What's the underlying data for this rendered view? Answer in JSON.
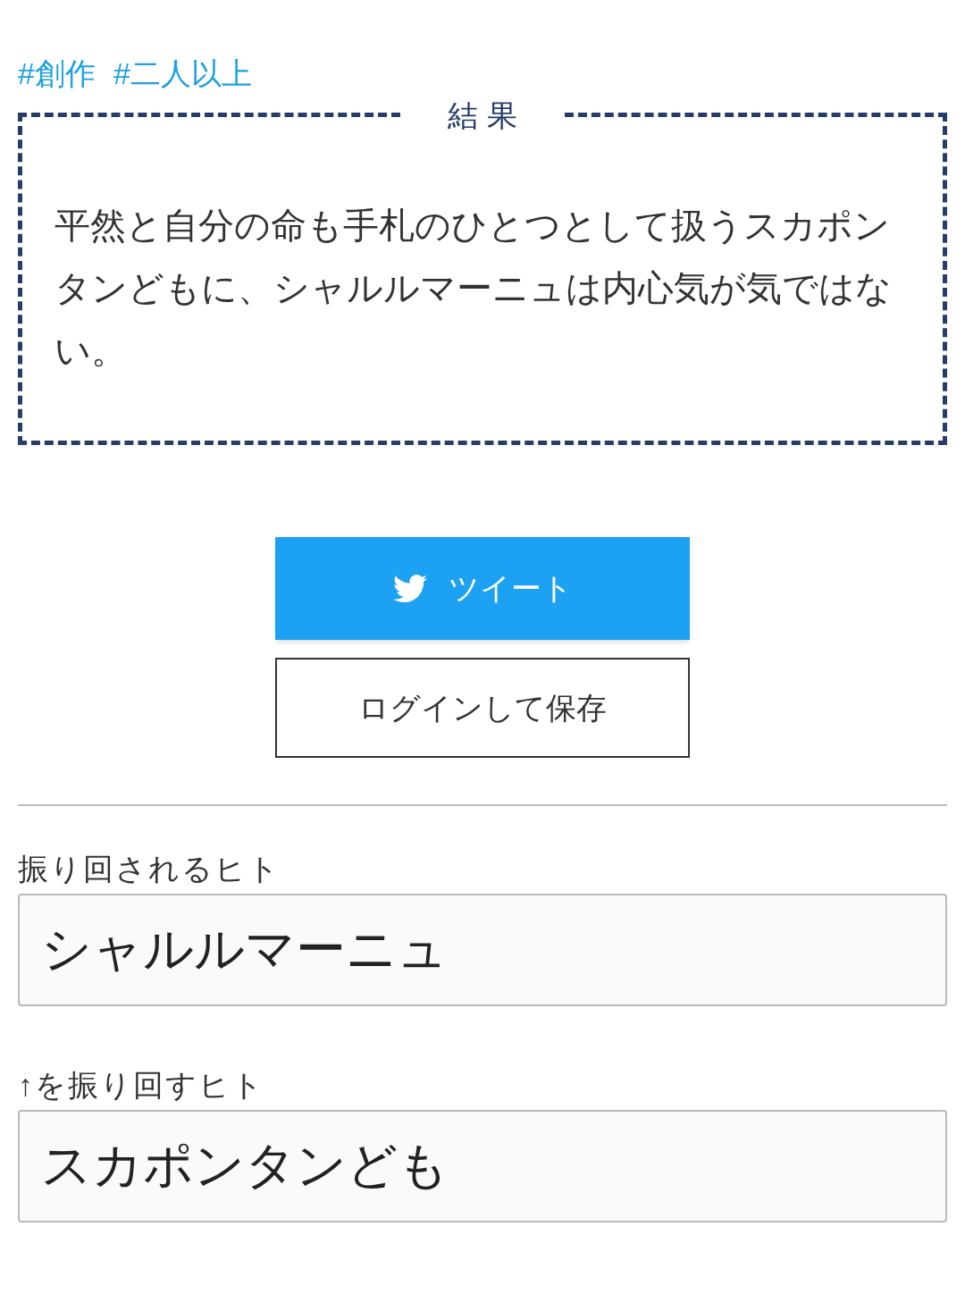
{
  "tags": [
    "#創作",
    "#二人以上"
  ],
  "result": {
    "heading": "結 果",
    "text": "平然と自分の命も手札のひとつとして扱うスカポンタンどもに、シャルルマーニュは内心気が気ではない。"
  },
  "buttons": {
    "tweet": "ツイート",
    "save": "ログインして保存"
  },
  "fields": [
    {
      "label": "振り回されるヒト",
      "value": "シャルルマーニュ"
    },
    {
      "label": "↑を振り回すヒト",
      "value": "スカポンタンども"
    }
  ]
}
